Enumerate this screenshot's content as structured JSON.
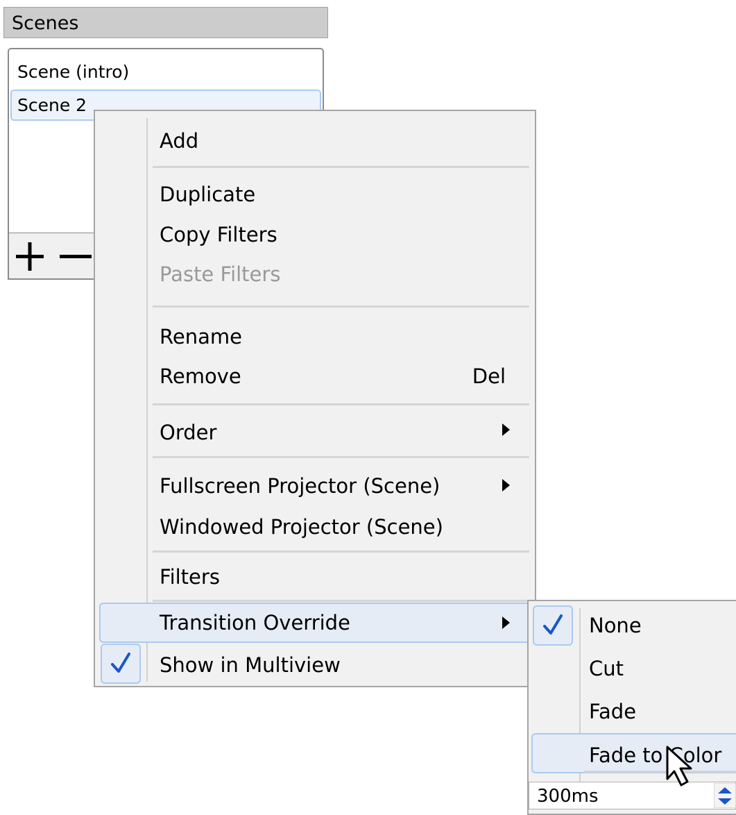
{
  "scenes_dock": {
    "title": "Scenes",
    "items": [
      {
        "label": "Scene (intro)",
        "selected": false
      },
      {
        "label": "Scene 2",
        "selected": true
      }
    ],
    "toolbar": {
      "add_icon": "plus-icon",
      "remove_icon": "minus-icon"
    }
  },
  "context_menu": {
    "add": "Add",
    "duplicate": "Duplicate",
    "copy_filters": "Copy Filters",
    "paste_filters": "Paste Filters",
    "rename": "Rename",
    "remove": "Remove",
    "remove_shortcut": "Del",
    "order": "Order",
    "fullscreen_projector": "Fullscreen Projector (Scene)",
    "windowed_projector": "Windowed Projector (Scene)",
    "filters": "Filters",
    "transition_override": "Transition Override",
    "show_in_multiview": "Show in Multiview",
    "show_in_multiview_checked": true
  },
  "transition_submenu": {
    "items": [
      "None",
      "Cut",
      "Fade",
      "Fade to Color"
    ],
    "checked": "None",
    "hovered": "Fade to Color",
    "duration": "300ms"
  },
  "colors": {
    "highlight_fill": "#e6ecf6",
    "highlight_border": "#aacaf0",
    "check": "#1a56c9",
    "menu_bg": "#f1f1f1"
  }
}
